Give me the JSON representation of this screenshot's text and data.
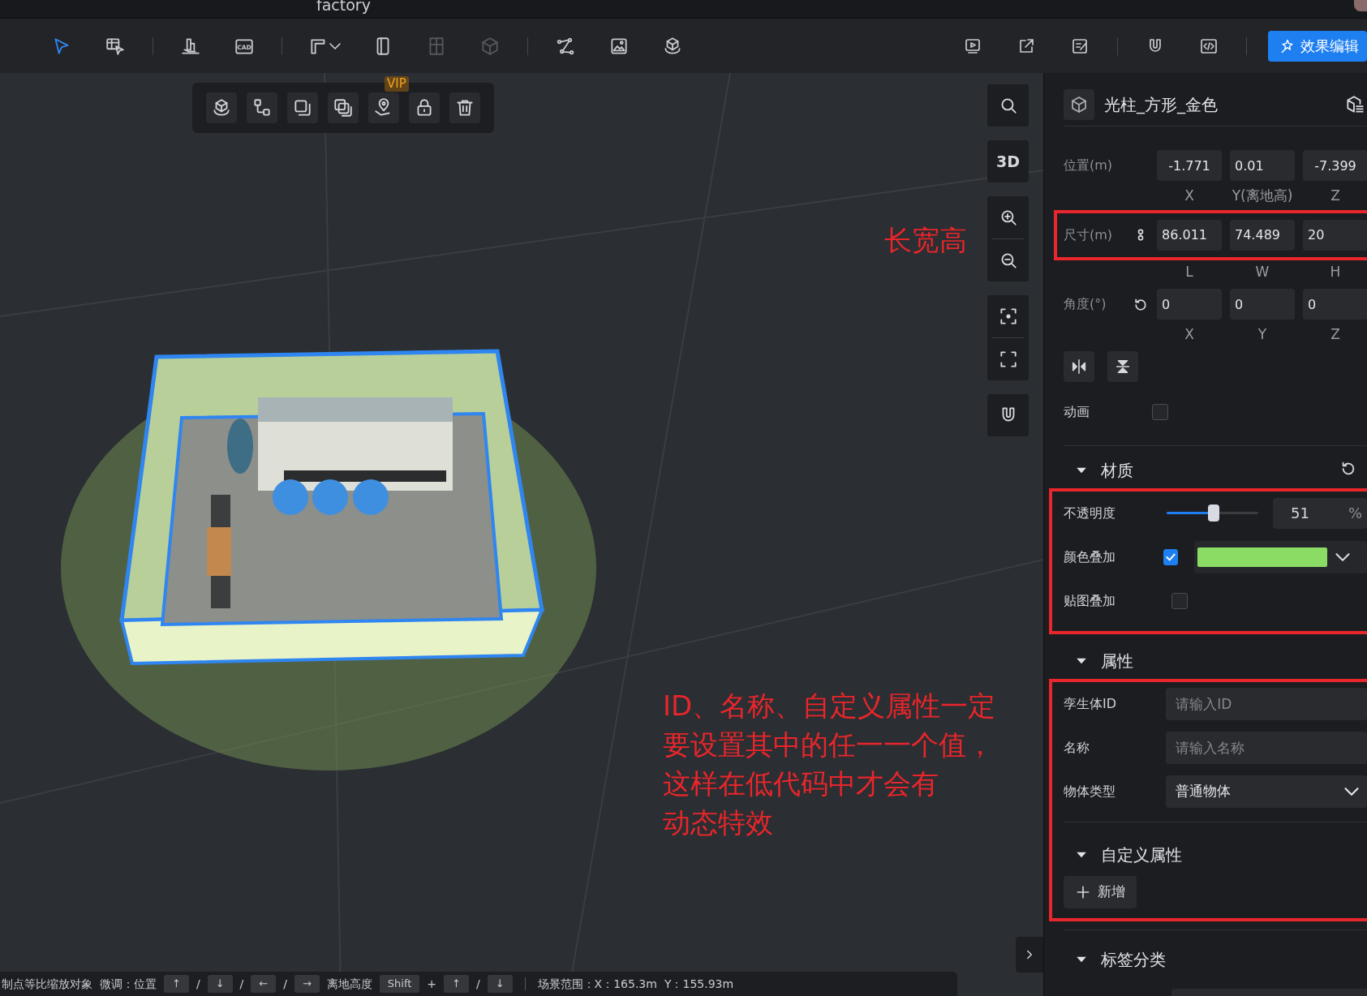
{
  "window": {
    "title": "factory"
  },
  "toolbar": {
    "left_tools": [
      {
        "selected": true,
        "disabled": false
      },
      {
        "selected": false,
        "disabled": false
      },
      {
        "selected": false,
        "disabled": false
      },
      {
        "selected": false,
        "disabled": false,
        "label": "CAD"
      },
      {
        "selected": false,
        "disabled": false
      },
      {
        "selected": false,
        "disabled": false
      },
      {
        "selected": false,
        "disabled": true
      },
      {
        "selected": false,
        "disabled": true
      },
      {
        "selected": false,
        "disabled": false
      },
      {
        "selected": false,
        "disabled": false
      },
      {
        "selected": false,
        "disabled": false
      }
    ],
    "right_tools": [
      {
        "disabled": false
      },
      {
        "disabled": false
      },
      {
        "disabled": false
      },
      {
        "disabled": false
      },
      {
        "disabled": false
      }
    ],
    "effect_button": "效果编辑"
  },
  "object_toolbar": [
    {
      "kind": "model"
    },
    {
      "kind": "connect"
    },
    {
      "kind": "copy"
    },
    {
      "kind": "duplicate"
    },
    {
      "kind": "location",
      "badge": "VIP"
    },
    {
      "kind": "lock"
    },
    {
      "kind": "delete"
    }
  ],
  "view_tools": {
    "view_mode": "3D"
  },
  "annotations": [
    {
      "lines": [
        "长宽高"
      ]
    },
    {
      "lines": [
        "ID、名称、自定义属性一定",
        "要设置其中的任一一个值，",
        "这样在低代码中才会有",
        "动态特效"
      ]
    }
  ],
  "status_bar": [
    {
      "kind": "text",
      "text": "制点等比缩放对象"
    },
    {
      "kind": "text",
      "text": "微调：位置"
    },
    {
      "kind": "key",
      "text": "↑"
    },
    {
      "kind": "text",
      "text": "/"
    },
    {
      "kind": "key",
      "text": "↓"
    },
    {
      "kind": "text",
      "text": "/"
    },
    {
      "kind": "key",
      "text": "←"
    },
    {
      "kind": "text",
      "text": "/"
    },
    {
      "kind": "key",
      "text": "→"
    },
    {
      "kind": "text",
      "text": "离地高度"
    },
    {
      "kind": "key",
      "text": "Shift"
    },
    {
      "kind": "text",
      "text": "+"
    },
    {
      "kind": "key",
      "text": "↑"
    },
    {
      "kind": "text",
      "text": "/"
    },
    {
      "kind": "key",
      "text": "↓"
    },
    {
      "kind": "divider"
    },
    {
      "kind": "text",
      "text": "场景范围：X：165.3m"
    },
    {
      "kind": "text",
      "text": "Y：155.93m"
    }
  ],
  "panel": {
    "title": "光柱_方形_金色",
    "transform": [
      {
        "label": "位置(m)",
        "kind": "plain",
        "values": [
          "-1.771",
          "0.01",
          "-7.399"
        ],
        "axes": [
          "X",
          "Y(离地高)",
          "Z"
        ]
      },
      {
        "label": "尺寸(m)",
        "kind": "linked",
        "highlighted": true,
        "values": [
          "86.011",
          "74.489",
          "20"
        ],
        "axes": [
          "L",
          "W",
          "H"
        ]
      },
      {
        "label": "角度(°)",
        "kind": "resettable",
        "values": [
          "0",
          "0",
          "0"
        ],
        "axes": [
          "X",
          "Y",
          "Z"
        ]
      }
    ],
    "animation": {
      "label": "动画",
      "checked": false
    },
    "material": {
      "title": "材质",
      "expanded": true,
      "highlighted": true,
      "opacity": {
        "label": "不透明度",
        "level": 0.51,
        "reading": "51",
        "unit": "%"
      },
      "color_overlay": {
        "label": "颜色叠加",
        "checked": true,
        "color": "#8bdc65"
      },
      "texture_overlay": {
        "label": "贴图叠加",
        "checked": false
      }
    },
    "properties": {
      "title": "属性",
      "expanded": true,
      "highlighted": true,
      "fields": [
        {
          "kind": "input",
          "label": "孪生体ID",
          "placeholder": "请输入ID"
        },
        {
          "kind": "input",
          "label": "名称",
          "placeholder": "请输入名称"
        },
        {
          "kind": "select",
          "label": "物体类型",
          "value": "普通物体"
        }
      ],
      "custom": {
        "title": "自定义属性",
        "expanded": true,
        "add_button": "新增"
      }
    },
    "tags": {
      "title": "标签分类",
      "expanded": true
    }
  }
}
